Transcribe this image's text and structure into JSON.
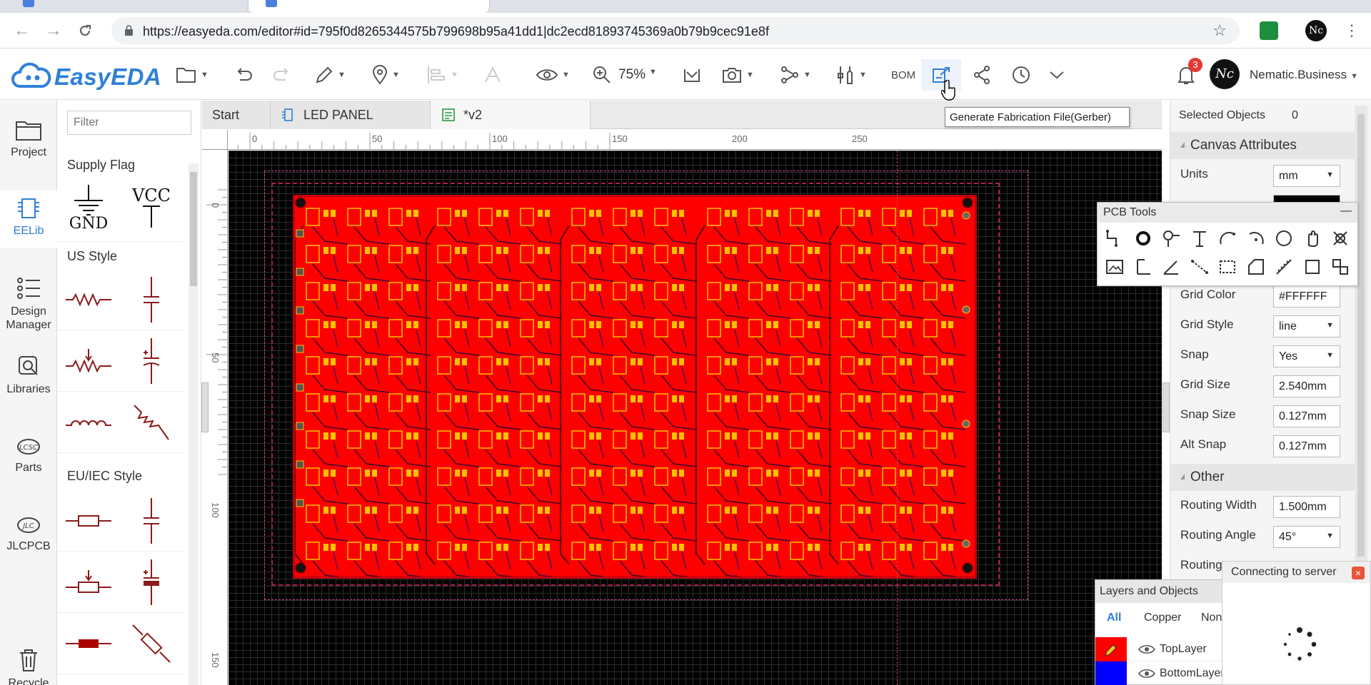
{
  "browser": {
    "url": "https://easyeda.com/editor#id=795f0d8265344575b799698b95a41dd1|dc2ecd81893745369a0b79b9cec91e8f",
    "profile_initials": "Nc"
  },
  "app": {
    "logo_text": "EasyEDA",
    "zoom_label": "75%",
    "bom_label": "BOM",
    "notification_count": "3",
    "user_initials": "Nc",
    "user_name": "Nematic.Business",
    "accent_color": "#2f80d8"
  },
  "tooltip": "Generate Fabrication File(Gerber)",
  "left_rail": {
    "items": [
      {
        "label": "Project",
        "icon": "folder-icon"
      },
      {
        "label": "EELib",
        "icon": "chip-icon"
      },
      {
        "label": "Design Manager",
        "icon": "list-icon"
      },
      {
        "label": "Libraries",
        "icon": "library-icon"
      },
      {
        "label": "Parts",
        "icon": "lcsc-icon"
      },
      {
        "label": "JLCPCB",
        "icon": "jlc-icon"
      },
      {
        "label": "Recycle",
        "icon": "trash-icon"
      }
    ]
  },
  "library": {
    "filter_placeholder": "Filter",
    "sections": [
      "Supply Flag",
      "US Style",
      "EU/IEC Style"
    ],
    "gnd_label": "GND",
    "vcc_label": "VCC"
  },
  "tabs": [
    {
      "label": "Start"
    },
    {
      "label": "LED PANEL"
    },
    {
      "label": "*v2"
    }
  ],
  "ruler": {
    "h_ticks": [
      "0",
      "50",
      "100",
      "150",
      "200",
      "250"
    ],
    "v_ticks": [
      "0",
      "50",
      "100",
      "150"
    ]
  },
  "right_panel": {
    "selected_label": "Selected Objects",
    "selected_count": "0",
    "canvas_section": "Canvas Attributes",
    "units_label": "Units",
    "units_value": "mm",
    "grid_color_label": "Grid Color",
    "grid_color_value": "#FFFFFF",
    "grid_style_label": "Grid Style",
    "grid_style_value": "line",
    "snap_label": "Snap",
    "snap_value": "Yes",
    "grid_size_label": "Grid Size",
    "grid_size_value": "2.540mm",
    "snap_size_label": "Snap Size",
    "snap_size_value": "0.127mm",
    "alt_snap_label": "Alt Snap",
    "alt_snap_value": "0.127mm",
    "other_section": "Other",
    "routing_width_label": "Routing Width",
    "routing_width_value": "1.500mm",
    "routing_angle_label": "Routing Angle",
    "routing_angle_value": "45°",
    "routing_label": "Routing"
  },
  "pcb_tools": {
    "title": "PCB Tools",
    "minimize": "—"
  },
  "layers": {
    "title": "Layers and Objects",
    "tabs": [
      "All",
      "Copper",
      "Non"
    ],
    "rows": [
      {
        "name": "TopLayer",
        "color": "#ff0000"
      },
      {
        "name": "BottomLayer",
        "color": "#0000ff"
      }
    ]
  },
  "connecting": {
    "text": "Connecting to server"
  },
  "board": {
    "color": "#ff0000"
  }
}
